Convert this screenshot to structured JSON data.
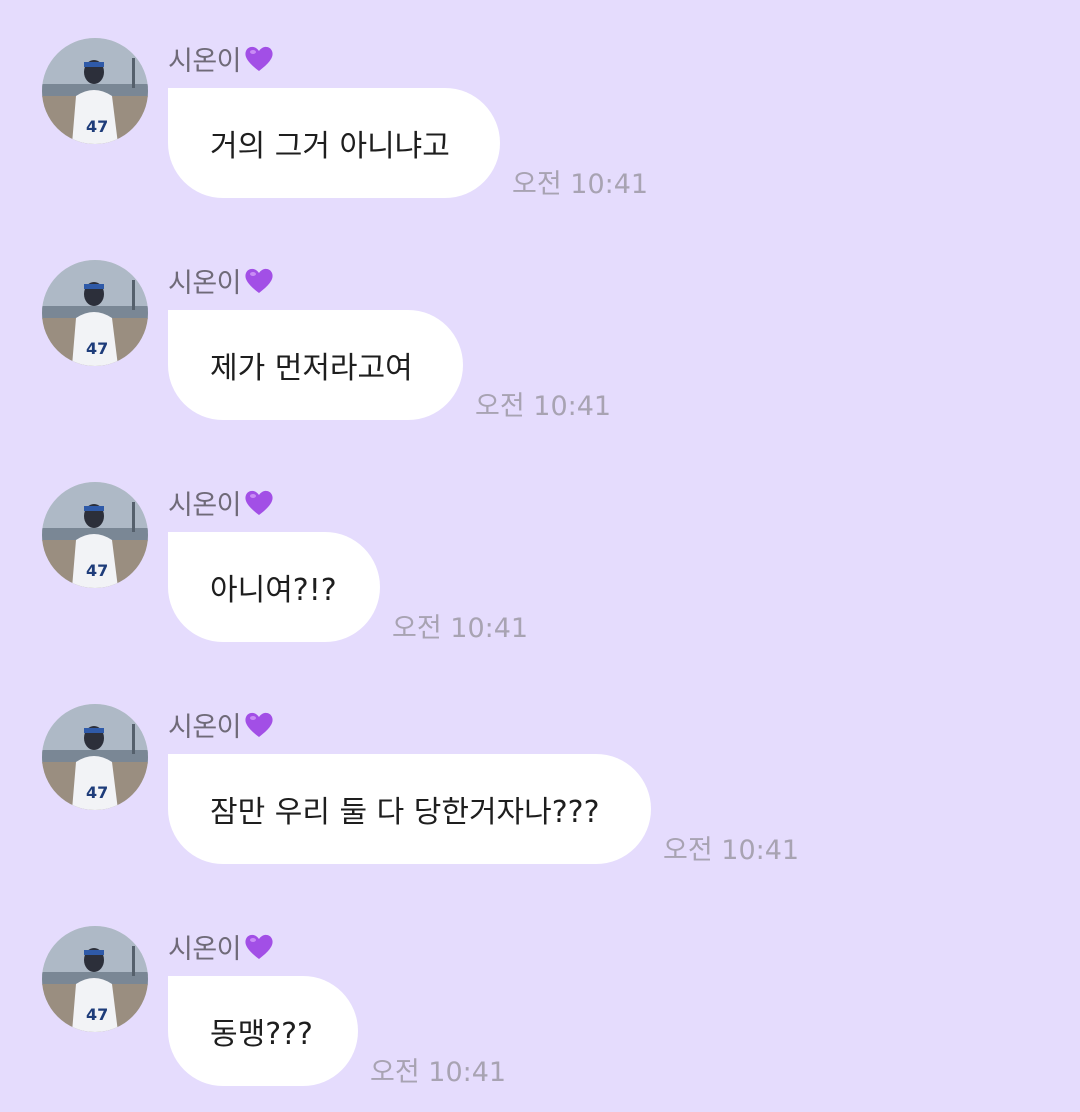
{
  "colors": {
    "background": "#e5dcfd",
    "bubble": "#ffffff",
    "sender_text": "#6f6a78",
    "time_text": "#a8a3b2",
    "heart": "#a24fe6"
  },
  "messages": [
    {
      "sender": "시온이",
      "sender_icon": "purple-heart-icon",
      "text": "거의 그거 아니냐고",
      "time": "오전 10:41"
    },
    {
      "sender": "시온이",
      "sender_icon": "purple-heart-icon",
      "text": "제가 먼저라고여",
      "time": "오전 10:41"
    },
    {
      "sender": "시온이",
      "sender_icon": "purple-heart-icon",
      "text": "아니여?!?",
      "time": "오전 10:41"
    },
    {
      "sender": "시온이",
      "sender_icon": "purple-heart-icon",
      "text": "잠만 우리 둘 다 당한거자나???",
      "time": "오전 10:41"
    },
    {
      "sender": "시온이",
      "sender_icon": "purple-heart-icon",
      "text": "동맹???",
      "time": "오전 10:41"
    }
  ]
}
